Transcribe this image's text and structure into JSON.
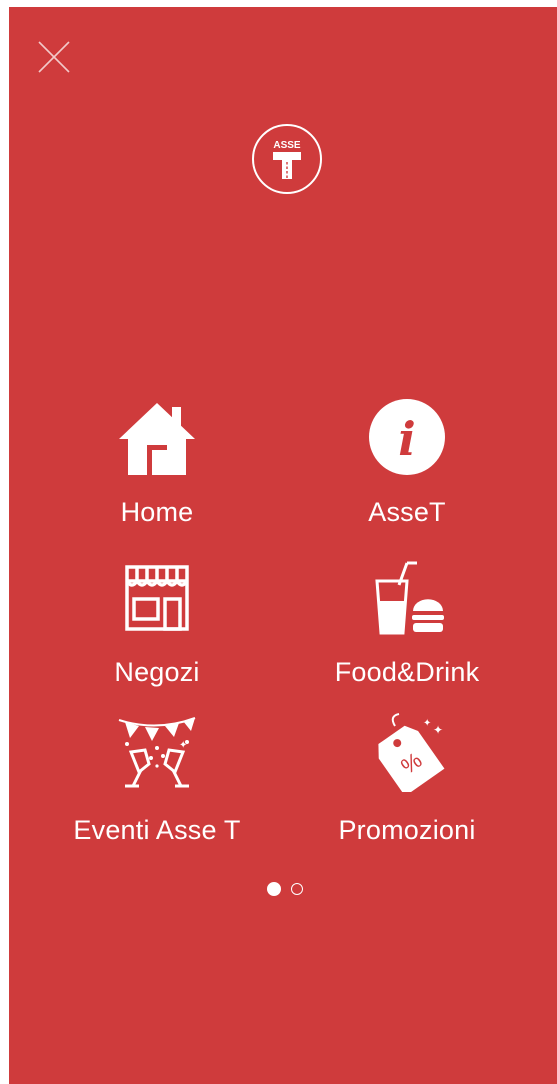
{
  "header": {
    "close_icon": "close-icon",
    "logo": {
      "text": "ASSE",
      "letter": "T"
    }
  },
  "menu": {
    "items": [
      {
        "label": "Home",
        "icon": "house-icon"
      },
      {
        "label": "AsseT",
        "icon": "info-icon"
      },
      {
        "label": "Negozi",
        "icon": "shop-icon"
      },
      {
        "label": "Food&Drink",
        "icon": "food-drink-icon"
      },
      {
        "label": "Eventi Asse T",
        "icon": "party-icon"
      },
      {
        "label": "Promozioni",
        "icon": "tag-percent-icon"
      }
    ]
  },
  "pager": {
    "total": 2,
    "current": 1
  },
  "colors": {
    "background": "#cf3b3c",
    "foreground": "#ffffff"
  }
}
